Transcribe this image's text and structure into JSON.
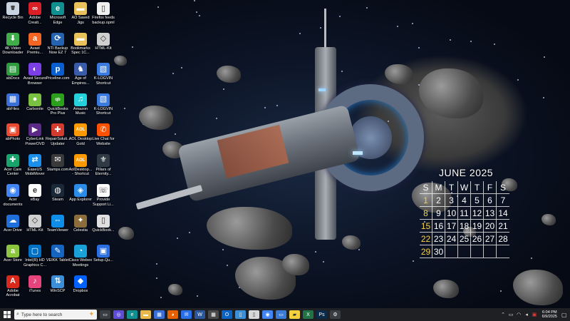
{
  "desktop_icons": [
    {
      "label": "Recycle Bin",
      "icon": "recycle-bin-icon",
      "color": "#c9d4e0",
      "glyph": "🗑"
    },
    {
      "label": "4K Video Downloader",
      "icon": "download-icon",
      "color": "#3fae49",
      "glyph": "⬇"
    },
    {
      "label": "abDocs",
      "icon": "abdocs-icon",
      "color": "#2e9b3e",
      "glyph": "▤"
    },
    {
      "label": "abFiles",
      "icon": "abfiles-icon",
      "color": "#3a6fd8",
      "glyph": "▦"
    },
    {
      "label": "abPhoto",
      "icon": "abphoto-icon",
      "color": "#e84a2f",
      "glyph": "▣"
    },
    {
      "label": "Acer Care Center",
      "icon": "acer-care-icon",
      "color": "#18a36b",
      "glyph": "✚"
    },
    {
      "label": "Acer documents",
      "icon": "chrome-icon",
      "color": "#4285f4",
      "glyph": "◉"
    },
    {
      "label": "Acer Drive",
      "icon": "acer-drive-icon",
      "color": "#1e6fd9",
      "glyph": "☁"
    },
    {
      "label": "Acer Store",
      "icon": "acer-store-icon",
      "color": "#8cc63f",
      "glyph": "a"
    },
    {
      "label": "Adobe Acrobat",
      "icon": "acrobat-icon",
      "color": "#d9291c",
      "glyph": "A"
    },
    {
      "label": "Adobe Creati...",
      "icon": "creative-cloud-icon",
      "color": "#da1f26",
      "glyph": "∞"
    },
    {
      "label": "Avast Premiu...",
      "icon": "avast-icon",
      "color": "#f26522",
      "glyph": "a"
    },
    {
      "label": "Avast Secure Browser",
      "icon": "avast-browser-icon",
      "color": "#7b3fe4",
      "glyph": "◐"
    },
    {
      "label": "Carbonite",
      "icon": "carbonite-icon",
      "color": "#7ac142",
      "glyph": "●"
    },
    {
      "label": "CyberLink PowerDVD 12",
      "icon": "powerdvd-icon",
      "color": "#5b2a86",
      "glyph": "▶"
    },
    {
      "label": "EaseUS MobiMover",
      "icon": "mobimover-icon",
      "color": "#1a8ee8",
      "glyph": "⇄"
    },
    {
      "label": "eBay",
      "icon": "ebay-icon",
      "color": "#ffffff",
      "glyph": "e"
    },
    {
      "label": "HTML-Kit",
      "icon": "html-kit-icon",
      "color": "#cfcfcf",
      "glyph": "◇"
    },
    {
      "label": "Intel(R) HD Graphics C...",
      "icon": "intel-icon",
      "color": "#0071c5",
      "glyph": "▢"
    },
    {
      "label": "iTunes",
      "icon": "itunes-icon",
      "color": "#e5447d",
      "glyph": "♪"
    },
    {
      "label": "Microsoft Edge",
      "icon": "edge-icon",
      "color": "#0f8f8f",
      "glyph": "e"
    },
    {
      "label": "NTI Backup Now EZ 7",
      "icon": "nti-backup-icon",
      "color": "#2563b0",
      "glyph": "⟳"
    },
    {
      "label": "Priceline.com",
      "icon": "priceline-icon",
      "color": "#0a5fcf",
      "glyph": "p"
    },
    {
      "label": "QuickBooks Pro Plus 2021",
      "icon": "quickbooks-icon",
      "color": "#2ca01c",
      "glyph": "qb"
    },
    {
      "label": "RepairSoluti... Updater",
      "icon": "repair-icon",
      "color": "#d43b2f",
      "glyph": "✚"
    },
    {
      "label": "Stamps.com",
      "icon": "stamps-icon",
      "color": "#3a3a3a",
      "glyph": "✉"
    },
    {
      "label": "Steam",
      "icon": "steam-icon",
      "color": "#1b2838",
      "glyph": "◍"
    },
    {
      "label": "TeamViewer",
      "icon": "teamviewer-icon",
      "color": "#0e8ee9",
      "glyph": "⇔"
    },
    {
      "label": "VEIKK Tablet",
      "icon": "veikk-icon",
      "color": "#1565c0",
      "glyph": "✎"
    },
    {
      "label": "WinSCP",
      "icon": "winscp-icon",
      "color": "#3c8fd6",
      "glyph": "⇅"
    },
    {
      "label": "AO Saved Jigs",
      "icon": "folder-icon",
      "color": "#e8c15a",
      "glyph": "▬"
    },
    {
      "label": "Bookmarks Spec 1C...",
      "icon": "folder-icon",
      "color": "#e8c15a",
      "glyph": "▬"
    },
    {
      "label": "Age of Empires...",
      "icon": "age-of-empires-icon",
      "color": "#3a5ca8",
      "glyph": "♞"
    },
    {
      "label": "Amazon Music",
      "icon": "amazon-music-icon",
      "color": "#25d1da",
      "glyph": "♫"
    },
    {
      "label": "AOL Desktop Gold",
      "icon": "aol-icon",
      "color": "#ff9900",
      "glyph": "AOL"
    },
    {
      "label": "AolDesktop... - Shortcut",
      "icon": "aol-shortcut-icon",
      "color": "#ff9900",
      "glyph": "AOL"
    },
    {
      "label": "App Explorer",
      "icon": "app-explorer-icon",
      "color": "#2a8be8",
      "glyph": "◈"
    },
    {
      "label": "Celestia",
      "icon": "celestia-icon",
      "color": "#8a6d3b",
      "glyph": "✦"
    },
    {
      "label": "Cisco Webex Meetings",
      "icon": "webex-icon",
      "color": "#1aa0d8",
      "glyph": "◔"
    },
    {
      "label": "Dropbox",
      "icon": "dropbox-icon",
      "color": "#0061fe",
      "glyph": "◆"
    },
    {
      "label": "Firefox feeds backup.opml",
      "icon": "file-icon",
      "color": "#f0f0f0",
      "glyph": "▯"
    },
    {
      "label": "HTML-Kit",
      "icon": "html-kit-icon",
      "color": "#cfcfcf",
      "glyph": "◇"
    },
    {
      "label": "K-LOGVIN Shortcut",
      "icon": "shortcut-icon",
      "color": "#3b7be0",
      "glyph": "▧"
    },
    {
      "label": "K-LOGVIN Shortcut",
      "icon": "shortcut-icon",
      "color": "#3b7be0",
      "glyph": "▧"
    },
    {
      "label": "Live Chat for Website",
      "icon": "live-chat-icon",
      "color": "#ff5100",
      "glyph": "✆"
    },
    {
      "label": "Pillars of Eternity...",
      "icon": "pillars-icon",
      "color": "#2f3a44",
      "glyph": "⚜"
    },
    {
      "label": "Provide Support Li...",
      "icon": "provide-support-icon",
      "color": "#ffffff",
      "glyph": "☏"
    },
    {
      "label": "QuickBook...",
      "icon": "quickbooks-file-icon",
      "color": "#e0e0e0",
      "glyph": "▯"
    },
    {
      "label": "Setup.Qu...",
      "icon": "setup-icon",
      "color": "#2b6fe0",
      "glyph": "▣"
    }
  ],
  "calendar": {
    "title": "JUNE 2025",
    "weekdays": [
      "S",
      "M",
      "T",
      "W",
      "T",
      "F",
      "S"
    ],
    "weeks": [
      [
        "1",
        "2",
        "3",
        "4",
        "5",
        "6",
        "7"
      ],
      [
        "8",
        "9",
        "10",
        "11",
        "12",
        "13",
        "14"
      ],
      [
        "15",
        "16",
        "17",
        "18",
        "19",
        "20",
        "21"
      ],
      [
        "22",
        "23",
        "24",
        "25",
        "26",
        "27",
        "28"
      ],
      [
        "29",
        "30",
        "",
        "",
        "",
        "",
        ""
      ]
    ],
    "sunday_color": "#f6d04a"
  },
  "taskbar": {
    "search_placeholder": "Type here to search",
    "apps": [
      {
        "icon": "task-view-icon",
        "color": "#3a3d42",
        "glyph": "▭"
      },
      {
        "icon": "copilot-icon",
        "color": "#5e4bd6",
        "glyph": "◎"
      },
      {
        "icon": "edge-icon",
        "color": "#0f8f8f",
        "glyph": "e"
      },
      {
        "icon": "file-explorer-icon",
        "color": "#e8b84a",
        "glyph": "▬"
      },
      {
        "icon": "store-icon",
        "color": "#3b6fd8",
        "glyph": "▦"
      },
      {
        "icon": "firefox-icon",
        "color": "#e66000",
        "glyph": "◕"
      },
      {
        "icon": "mail-icon",
        "color": "#2a6ee8",
        "glyph": "✉"
      },
      {
        "icon": "word-icon",
        "color": "#2b579a",
        "glyph": "W"
      },
      {
        "icon": "calculator-icon",
        "color": "#4a4a4a",
        "glyph": "▦"
      },
      {
        "icon": "outlook-icon",
        "color": "#0a64c8",
        "glyph": "O"
      },
      {
        "icon": "notepad-icon",
        "color": "#3c8fd6",
        "glyph": "▯"
      },
      {
        "icon": "file-icon",
        "color": "#d8d8d8",
        "glyph": "▯"
      },
      {
        "icon": "chrome-icon",
        "color": "#4285f4",
        "glyph": "◉"
      },
      {
        "icon": "remote-desktop-icon",
        "color": "#3a7bd5",
        "glyph": "▭"
      },
      {
        "icon": "sticky-notes-icon",
        "color": "#f4d03f",
        "glyph": "▰"
      },
      {
        "icon": "excel-icon",
        "color": "#217346",
        "glyph": "X"
      },
      {
        "icon": "photoshop-icon",
        "color": "#0a2a4a",
        "glyph": "Ps"
      },
      {
        "icon": "settings-icon",
        "color": "#3a3d42",
        "glyph": "⚙"
      }
    ],
    "clock_time": "6:04 PM",
    "clock_date": "6/9/2025"
  }
}
